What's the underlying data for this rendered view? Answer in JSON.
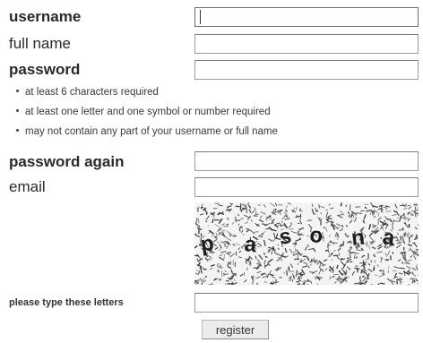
{
  "form": {
    "username_label": "username",
    "username_value": "",
    "fullname_label": "full name",
    "fullname_value": "",
    "password_label": "password",
    "password_value": "",
    "password_rules": [
      "at least 6 characters required",
      "at least one letter and one symbol or number required",
      "may not contain any part of your username or full name"
    ],
    "password_again_label": "password again",
    "password_again_value": "",
    "email_label": "email",
    "email_value": "",
    "captcha": {
      "letters": [
        "p",
        "a",
        "s",
        "o",
        "n",
        "a"
      ]
    },
    "captcha_prompt_label": "please type these letters",
    "captcha_value": "",
    "register_label": "register"
  }
}
